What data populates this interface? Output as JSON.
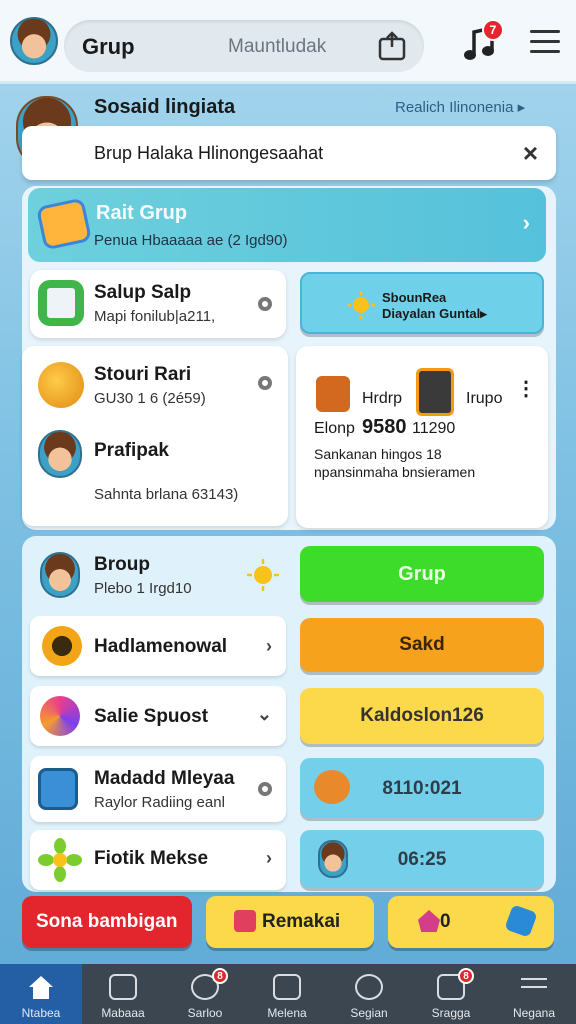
{
  "header": {
    "title": "Grup",
    "search_placeholder": "Mauntludak",
    "music_badge": "7"
  },
  "section": {
    "title": "Sosaid lingiata",
    "region": "Realich Ilinonenia ▸"
  },
  "notice": {
    "text": "Brup Halaka Hlinongesaahat",
    "close": "×"
  },
  "banner": {
    "title": "Rait Grup",
    "subtitle": "Penua Hbaaaaa ae (2 Igd90)",
    "chevron": "›"
  },
  "cards": {
    "salup": {
      "title": "Salup Salp",
      "sub": "Mapi fonilub|a211,"
    },
    "sun_pill": {
      "line1": "SbounRea",
      "line2": "Diayalan Guntal▸"
    },
    "stouri": {
      "title": "Stouri Rari",
      "sub": "GU30 1 6 (2é59)"
    },
    "profile": {
      "title": "Prafipak",
      "sub": "Sahnta brlana 63143)"
    },
    "promo": {
      "label1": "Hrdrp",
      "label2": "Irupo",
      "line_a": "Elonp",
      "value": "9580",
      "line_b": "11290",
      "desc1": "Sankanan hingos 18",
      "desc2": "npansinmaha bnsieramen",
      "more": "⋮"
    }
  },
  "list": [
    {
      "title": "Broup",
      "sub": "Plebo 1 Irgd10",
      "icon": "avatar-icon",
      "chev": ""
    },
    {
      "title": "Hadlamenowal",
      "sub": "",
      "icon": "globe-icon",
      "chev": "›"
    },
    {
      "title": "Salie Spuost",
      "sub": "",
      "icon": "swirl-icon",
      "chev": "⌄"
    },
    {
      "title": "Madadd Mleyaa",
      "sub": "Raylor Radiing eanl",
      "icon": "tablet-icon",
      "chev": ""
    },
    {
      "title": "Fiotik Mekse",
      "sub": "",
      "icon": "flower-icon",
      "chev": "›"
    }
  ],
  "pills": {
    "grup": "Grup",
    "sakd": "Sakd",
    "kados": "Kaldoslon126",
    "time1": "8110:021",
    "time2": "06:25"
  },
  "actions": {
    "red": "Sona bambigan",
    "yellow": "Remakai",
    "count": "0"
  },
  "nav": [
    {
      "label": "Ntabea",
      "badge": ""
    },
    {
      "label": "Mabaaa",
      "badge": ""
    },
    {
      "label": "Sarloo",
      "badge": "8"
    },
    {
      "label": "Melena",
      "badge": ""
    },
    {
      "label": "Segian",
      "badge": ""
    },
    {
      "label": "Sragga",
      "badge": "8"
    },
    {
      "label": "Negana",
      "badge": ""
    }
  ],
  "colors": {
    "green_pill": "#3ddc2b",
    "orange_pill": "#f6a21c",
    "yellow_pill": "#fbd94a",
    "cyan_pill": "#73cfea",
    "red_action": "#e3262d",
    "nav_active": "#245fa6"
  }
}
